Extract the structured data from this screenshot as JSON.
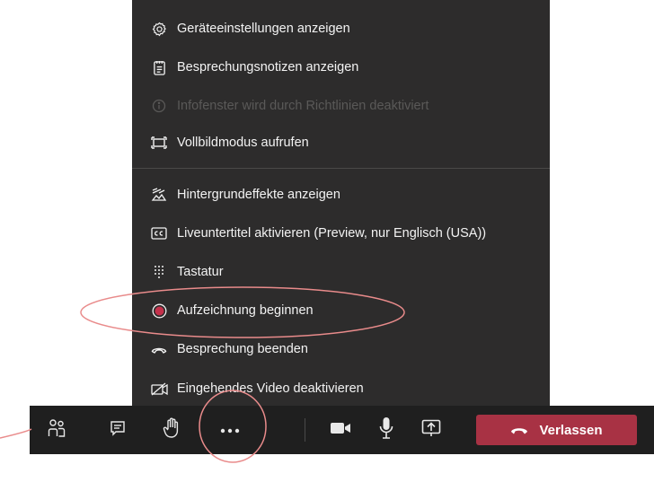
{
  "menu": {
    "items": [
      {
        "label": "Geräteeinstellungen anzeigen",
        "icon": "gear-icon",
        "enabled": true
      },
      {
        "label": "Besprechungsnotizen anzeigen",
        "icon": "notes-icon",
        "enabled": true
      },
      {
        "label": "Infofenster wird durch Richtlinien deaktiviert",
        "icon": "info-icon",
        "enabled": false
      },
      {
        "label": "Vollbildmodus aufrufen",
        "icon": "fullscreen-icon",
        "enabled": true
      },
      {
        "label": "Hintergrundeffekte anzeigen",
        "icon": "background-effects-icon",
        "enabled": true
      },
      {
        "label": "Liveuntertitel aktivieren (Preview, nur Englisch (USA))",
        "icon": "closed-captions-icon",
        "enabled": true
      },
      {
        "label": "Tastatur",
        "icon": "keypad-icon",
        "enabled": true
      },
      {
        "label": "Aufzeichnung beginnen",
        "icon": "record-icon",
        "enabled": true
      },
      {
        "label": "Besprechung beenden",
        "icon": "hang-up-icon",
        "enabled": true
      },
      {
        "label": "Eingehendes Video deaktivieren",
        "icon": "video-off-icon",
        "enabled": true
      }
    ]
  },
  "toolbar": {
    "buttons": [
      "participants-icon",
      "chat-icon",
      "raise-hand-icon",
      "more-options-icon",
      "camera-icon",
      "microphone-icon",
      "share-screen-icon"
    ],
    "leave_label": "Verlassen"
  },
  "colors": {
    "menu_bg": "#2d2c2c",
    "toolbar_bg": "#1f1f1f",
    "leave_bg": "#a83244",
    "record_dot": "#c4314b",
    "annotation": "#e98b8b"
  }
}
